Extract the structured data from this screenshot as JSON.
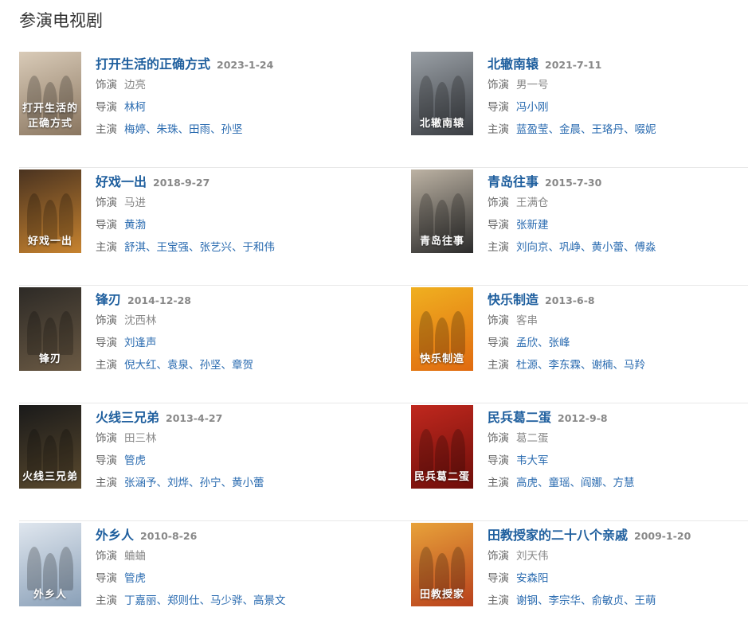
{
  "section": {
    "title": "参演电视剧"
  },
  "labels": {
    "role": "饰演",
    "director": "导演",
    "cast": "主演",
    "separator": "、"
  },
  "shows": [
    {
      "title": "打开生活的正确方式",
      "date": "2023-1-24",
      "role": "边亮",
      "director": [
        "林柯"
      ],
      "cast": [
        "梅婷",
        "朱珠",
        "田雨",
        "孙坚"
      ],
      "poster_text": "打开生活的正确方式",
      "poster_colors": [
        "#d9cbb8",
        "#8a7660"
      ]
    },
    {
      "title": "北辙南辕",
      "date": "2021-7-11",
      "role": "男一号",
      "director": [
        "冯小刚"
      ],
      "cast": [
        "蓝盈莹",
        "金晨",
        "王珞丹",
        "啜妮"
      ],
      "poster_text": "北辙南辕",
      "poster_colors": [
        "#9aa0a6",
        "#3a3d42"
      ]
    },
    {
      "title": "好戏一出",
      "date": "2018-9-27",
      "role": "马进",
      "director": [
        "黄渤"
      ],
      "cast": [
        "舒淇",
        "王宝强",
        "张艺兴",
        "于和伟"
      ],
      "poster_text": "好戏一出",
      "poster_colors": [
        "#4a3320",
        "#c7832f"
      ]
    },
    {
      "title": "青岛往事",
      "date": "2015-7-30",
      "role": "王满仓",
      "director": [
        "张新建"
      ],
      "cast": [
        "刘向京",
        "巩峥",
        "黄小蕾",
        "傅淼"
      ],
      "poster_text": "青岛往事",
      "poster_colors": [
        "#bdb3a4",
        "#2b2b2b"
      ]
    },
    {
      "title": "锋刃",
      "date": "2014-12-28",
      "role": "沈西林",
      "director": [
        "刘逢声"
      ],
      "cast": [
        "倪大红",
        "袁泉",
        "孙坚",
        "章贺"
      ],
      "poster_text": "锋刃",
      "poster_colors": [
        "#2d2a26",
        "#6b5a44"
      ]
    },
    {
      "title": "快乐制造",
      "date": "2013-6-8",
      "role": "客串",
      "director": [
        "孟欣",
        "张峰"
      ],
      "cast": [
        "杜源",
        "李东霖",
        "谢楠",
        "马羚"
      ],
      "poster_text": "快乐制造",
      "poster_colors": [
        "#f0b020",
        "#e06a10"
      ]
    },
    {
      "title": "火线三兄弟",
      "date": "2013-4-27",
      "role": "田三林",
      "director": [
        "管虎"
      ],
      "cast": [
        "张涵予",
        "刘烨",
        "孙宁",
        "黄小蕾"
      ],
      "poster_text": "火线三兄弟",
      "poster_colors": [
        "#1a1a1a",
        "#5b4a2e"
      ]
    },
    {
      "title": "民兵葛二蛋",
      "date": "2012-9-8",
      "role": "葛二蛋",
      "director": [
        "韦大军"
      ],
      "cast": [
        "高虎",
        "童瑶",
        "阎娜",
        "方慧"
      ],
      "poster_text": "民兵葛二蛋",
      "poster_colors": [
        "#c0281e",
        "#6e0e0a"
      ]
    },
    {
      "title": "外乡人",
      "date": "2010-8-26",
      "role": "蛐蛐",
      "director": [
        "管虎"
      ],
      "cast": [
        "丁嘉丽",
        "郑则仕",
        "马少骅",
        "高景文"
      ],
      "poster_text": "外乡人",
      "poster_colors": [
        "#dfe6ee",
        "#8aa0b8"
      ]
    },
    {
      "title": "田教授家的二十八个亲戚",
      "date": "2009-1-20",
      "role": "刘天伟",
      "director": [
        "安森阳"
      ],
      "cast": [
        "谢钢",
        "李宗华",
        "俞敏贞",
        "王萌"
      ],
      "poster_text": "田教授家",
      "poster_colors": [
        "#e8a23a",
        "#b8401c"
      ]
    }
  ]
}
